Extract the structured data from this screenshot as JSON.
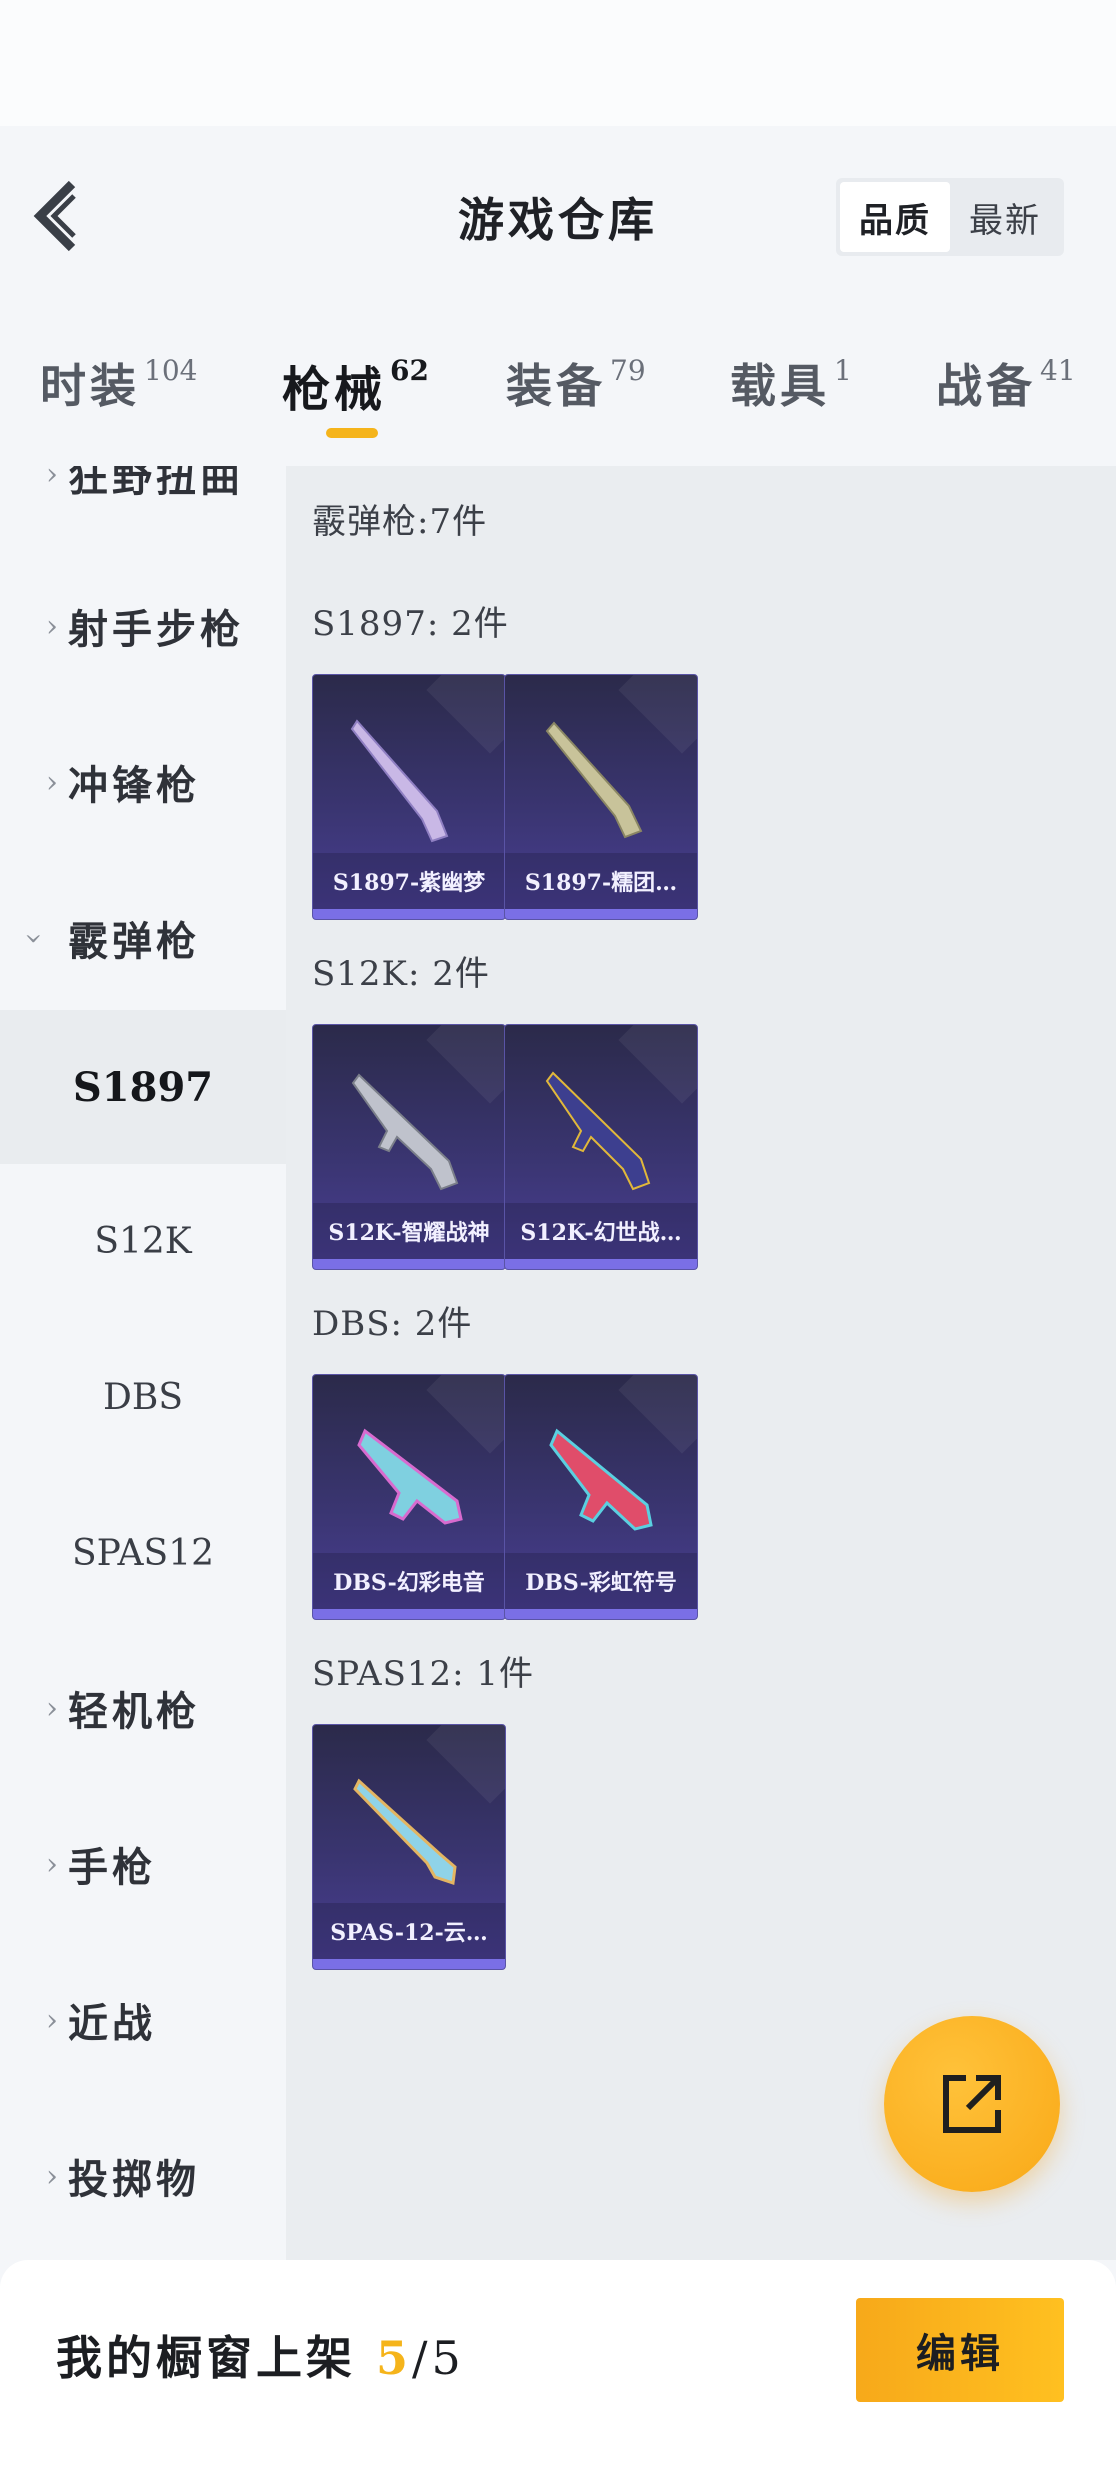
{
  "header": {
    "title": "游戏仓库",
    "sort_options": [
      "品质",
      "最新"
    ],
    "sort_active": "品质"
  },
  "tabs": [
    {
      "label": "时装",
      "count": "104"
    },
    {
      "label": "枪械",
      "count": "62"
    },
    {
      "label": "装备",
      "count": "79"
    },
    {
      "label": "载具",
      "count": "1"
    },
    {
      "label": "战备",
      "count": "41"
    }
  ],
  "sidebar": {
    "categories": [
      {
        "label": "狂野扭曲",
        "expanded": false
      },
      {
        "label": "射手步枪",
        "expanded": false
      },
      {
        "label": "冲锋枪",
        "expanded": false
      },
      {
        "label": "霰弹枪",
        "expanded": true
      },
      {
        "label": "轻机枪",
        "expanded": false
      },
      {
        "label": "手枪",
        "expanded": false
      },
      {
        "label": "近战",
        "expanded": false
      },
      {
        "label": "投掷物",
        "expanded": false
      }
    ],
    "subitems": [
      "S1897",
      "S12K",
      "DBS",
      "SPAS12"
    ],
    "active_sub": "S1897"
  },
  "content": {
    "category_total": "霰弹枪:7件",
    "sections": [
      {
        "title": "S1897: 2件",
        "items": [
          "S1897-紫幽梦",
          "S1897-糯团…"
        ]
      },
      {
        "title": "S12K: 2件",
        "items": [
          "S12K-智耀战神",
          "S12K-幻世战…"
        ]
      },
      {
        "title": "DBS: 2件",
        "items": [
          "DBS-幻彩电音",
          "DBS-彩虹符号"
        ]
      },
      {
        "title": "SPAS12: 1件",
        "items": [
          "SPAS-12-云…"
        ]
      }
    ]
  },
  "footer": {
    "prefix": "我的橱窗上架 ",
    "current": "5",
    "sep_total": "/5",
    "edit_label": "编辑"
  },
  "colors": {
    "accent": "#f5b41b",
    "card_bg": "#3a3571",
    "card_bar": "#7a6fe6"
  }
}
